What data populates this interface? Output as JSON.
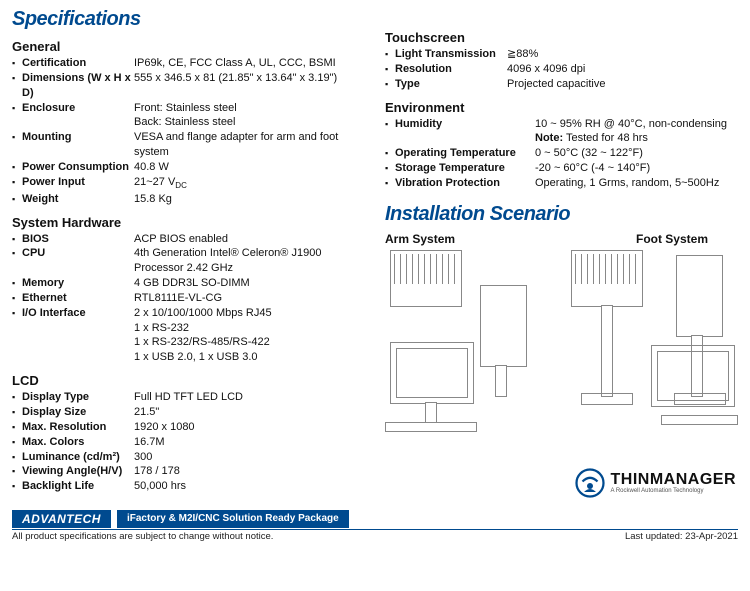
{
  "title": "Specifications",
  "general": {
    "heading": "General",
    "items": [
      {
        "label": "Certification",
        "value": "IP69k, CE, FCC Class A, UL, CCC, BSMI"
      },
      {
        "label": "Dimensions (W x H x D)",
        "value": "555 x 346.5 x 81 (21.85\" x 13.64\" x 3.19\")"
      },
      {
        "label": "Enclosure",
        "value": "Front: Stainless steel\nBack: Stainless steel"
      },
      {
        "label": "Mounting",
        "value": "VESA and flange adapter for arm and foot system"
      },
      {
        "label": "Power Consumption",
        "value": "40.8 W"
      },
      {
        "label": "Power Input",
        "value": "21~27 V_DC"
      },
      {
        "label": "Weight",
        "value": "15.8 Kg"
      }
    ]
  },
  "system_hw": {
    "heading": "System Hardware",
    "items": [
      {
        "label": "BIOS",
        "value": "ACP BIOS enabled"
      },
      {
        "label": "CPU",
        "value": "4th Generation Intel® Celeron® J1900 Processor 2.42 GHz"
      },
      {
        "label": "Memory",
        "value": "4 GB DDR3L SO-DIMM"
      },
      {
        "label": "Ethernet",
        "value": "RTL8111E-VL-CG"
      },
      {
        "label": "I/O Interface",
        "value": "2 x 10/100/1000 Mbps RJ45\n1 x RS-232\n1 x RS-232/RS-485/RS-422\n1 x USB 2.0, 1 x USB 3.0"
      }
    ]
  },
  "lcd": {
    "heading": "LCD",
    "items": [
      {
        "label": "Display Type",
        "value": "Full HD TFT LED LCD"
      },
      {
        "label": "Display Size",
        "value": "21.5\""
      },
      {
        "label": "Max. Resolution",
        "value": "1920 x 1080"
      },
      {
        "label": "Max. Colors",
        "value": "16.7M"
      },
      {
        "label": "Luminance (cd/m²)",
        "value": "300"
      },
      {
        "label": "Viewing Angle(H/V)",
        "value": "178 / 178"
      },
      {
        "label": "Backlight Life",
        "value": " 50,000 hrs"
      }
    ]
  },
  "touchscreen": {
    "heading": "Touchscreen",
    "items": [
      {
        "label": "Light Transmission",
        "value": "≧88%"
      },
      {
        "label": "Resolution",
        "value": "4096 x 4096 dpi"
      },
      {
        "label": "Type",
        "value": "Projected capacitive"
      }
    ]
  },
  "environment": {
    "heading": "Environment",
    "items": [
      {
        "label": "Humidity",
        "value": "10 ~ 95% RH @ 40°C, non-condensing\n**Note:** Tested for 48 hrs"
      },
      {
        "label": "Operating Temperature",
        "value": "0 ~ 50°C (32 ~ 122°F)"
      },
      {
        "label": "Storage Temperature",
        "value": "-20 ~ 60°C (-4 ~ 140°F)"
      },
      {
        "label": "Vibration Protection",
        "value": "Operating, 1 Grms, random, 5~500Hz"
      }
    ]
  },
  "install": {
    "title": "Installation Scenario",
    "arm": "Arm System",
    "foot": "Foot System"
  },
  "brand": {
    "name": "THINMANAGER",
    "tagline": "A Rockwell Automation Technology"
  },
  "footer": {
    "company": "ADVANTECH",
    "package": "iFactory & M2I/CNC Solution Ready Package",
    "disclaimer": "All product specifications are subject to change without notice.",
    "updated": "Last updated: 23-Apr-2021"
  }
}
